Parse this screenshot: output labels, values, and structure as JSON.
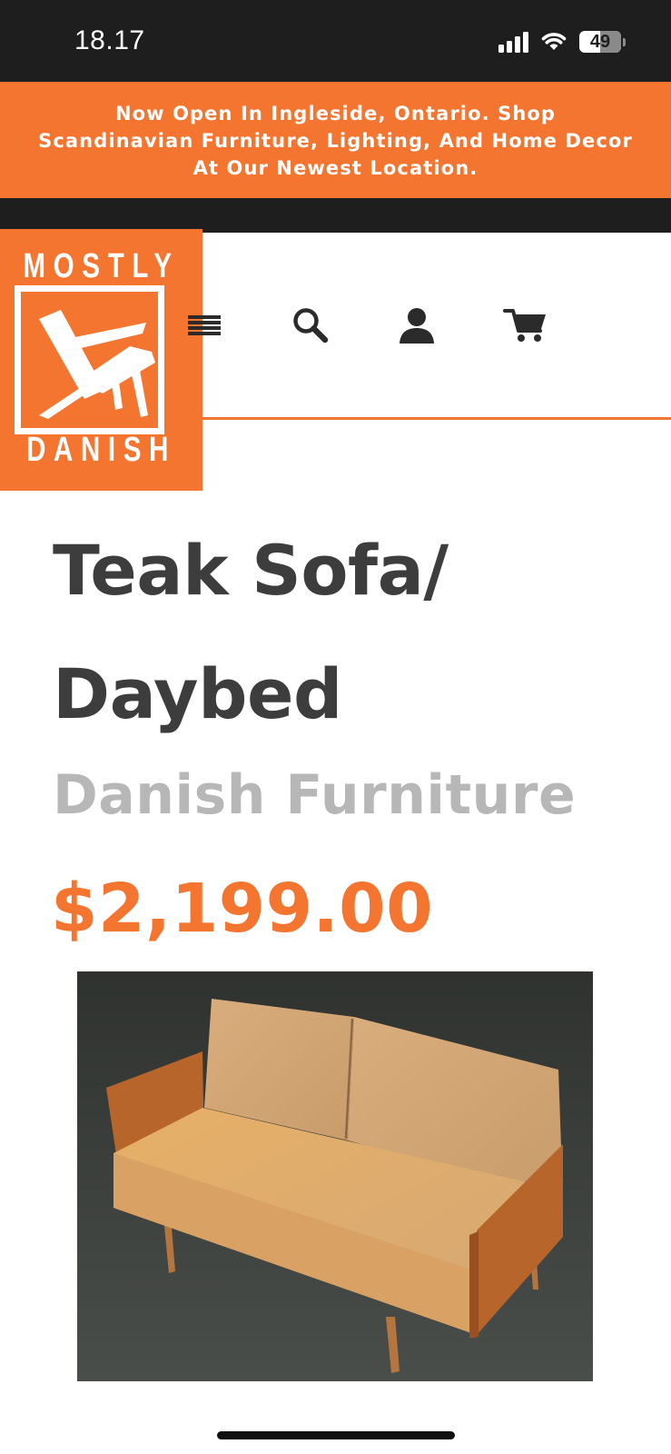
{
  "status_bar": {
    "time": "18.17",
    "battery_level": "49",
    "icons": [
      "signal-icon",
      "wifi-icon",
      "battery-icon"
    ]
  },
  "promo_banner": {
    "lines": [
      "Now Open In Ingleside, Ontario. Shop",
      "Scandinavian Furniture, Lighting, And Home Decor",
      "At Our Newest Location."
    ]
  },
  "logo": {
    "top_word": "MOSTLY",
    "bottom_word": "DANISH"
  },
  "header": {
    "icons": [
      "menu-icon",
      "search-icon",
      "account-icon",
      "cart-icon"
    ]
  },
  "product": {
    "title_line_1": "Teak Sofa/",
    "title_line_2": "Daybed",
    "category": "Danish Furniture",
    "price": "$2,199.00",
    "image": "teak-sofa-daybed-photo"
  },
  "colors": {
    "brand_orange": "#f47530",
    "dark_bar": "#1e1e1e",
    "title_text": "#3d3d3d",
    "category_text": "#b7b7b7"
  }
}
